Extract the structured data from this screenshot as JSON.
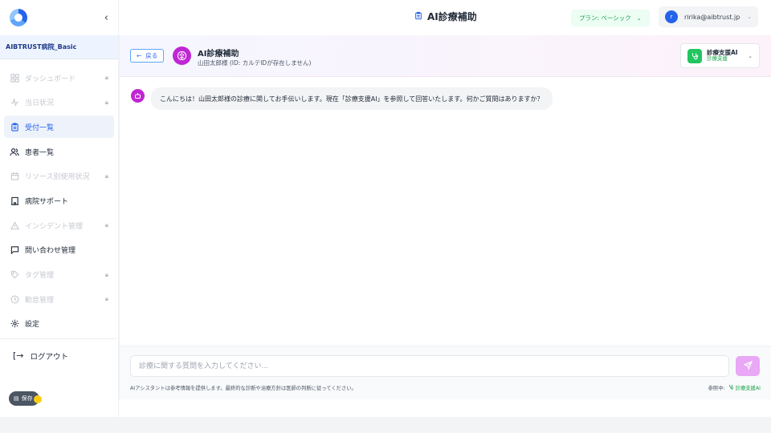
{
  "sidebar": {
    "collapse_icon": "chevron-left-icon",
    "hospital_name": "AIBTRUST病院_Basic",
    "items": [
      {
        "label": "ダッシュボード",
        "icon": "grid-icon",
        "locked": true
      },
      {
        "label": "当日状況",
        "icon": "activity-icon",
        "locked": true
      },
      {
        "label": "受付一覧",
        "icon": "clipboard-icon",
        "locked": false,
        "active": true
      },
      {
        "label": "患者一覧",
        "icon": "users-icon",
        "locked": false
      },
      {
        "label": "リソース別使用状況",
        "icon": "calendar-icon",
        "locked": true
      },
      {
        "label": "病院サポート",
        "icon": "building-icon",
        "locked": false
      },
      {
        "label": "インシデント管理",
        "icon": "warning-icon",
        "locked": true
      },
      {
        "label": "問い合わせ管理",
        "icon": "message-icon",
        "locked": false
      },
      {
        "label": "タグ管理",
        "icon": "tag-icon",
        "locked": true
      },
      {
        "label": "勤怠管理",
        "icon": "clock-icon",
        "locked": true
      },
      {
        "label": "設定",
        "icon": "gear-icon",
        "locked": false
      }
    ],
    "logout_label": "ログアウト",
    "pending_label": "保存"
  },
  "header": {
    "title": "AI診療補助",
    "plan_label": "プラン: ベーシック",
    "user_initial": "r",
    "user_email": "ririka@aibtrust.jp"
  },
  "chat": {
    "back_label": "戻る",
    "title": "AI診療補助",
    "subtitle": "山田太郎様 (ID: カルテIDが存在しません)",
    "model": {
      "name": "診療支援AI",
      "tag": "診療支援"
    },
    "messages": [
      {
        "role": "assistant",
        "text": "こんにちは！山田太郎様の診療に関してお手伝いします。現在「診療支援AI」を参照して回答いたします。何かご質問はありますか？"
      }
    ],
    "input_placeholder": "診療に関する質問を入力してください...",
    "disclaimer": "AIアシスタントは参考情報を提供します。最終的な診断や治療方針は医師の判断に従ってください。",
    "ref_prefix": "参照中:",
    "ref_name": "診療支援AI"
  },
  "colors": {
    "accent": "#2563eb",
    "bot": "#c026d3",
    "success": "#16a34a"
  }
}
